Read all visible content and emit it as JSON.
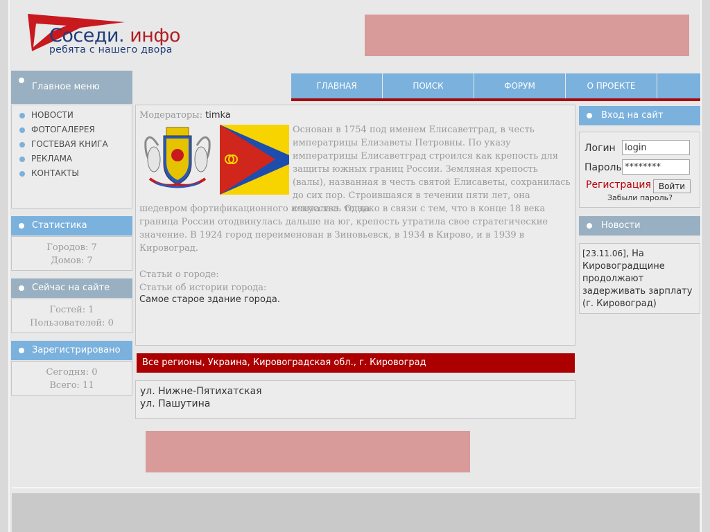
{
  "logo": {
    "name_main": "Соседи.",
    "name_accent": " инфо",
    "tagline": "ребята с нашего двора"
  },
  "left": {
    "main_menu": {
      "title": "Главное меню",
      "items": [
        "НОВОСТИ",
        "ФОТОГАЛЕРЕЯ",
        "ГОСТЕВАЯ КНИГА",
        "РЕКЛАМА",
        "КОНТАКТЫ"
      ]
    },
    "stats": {
      "title": "Статистика",
      "cities": "Городов: 7",
      "houses": "Домов: 7"
    },
    "online": {
      "title": "Сейчас на сайте",
      "guests": "Гостей: 1",
      "users": "Пользователей: 0"
    },
    "registered": {
      "title": "Зарегистрировано",
      "today": "Сегодня: 0",
      "total": "Всего: 11"
    }
  },
  "nav": {
    "items": [
      "ГЛАВНАЯ",
      "ПОИСК",
      "ФОРУМ",
      "О ПРОЕКТЕ"
    ]
  },
  "content": {
    "moderators_label": "Модераторы:",
    "moderator": "timka",
    "description_top": "Основан в 1754 под именем Елисаветград, в честь императрицы Елизаветы Петровны. По указу императрицы Елисаветград строился как крепость для защиты южных границ России. Земляная крепость (валы), названная в честь святой Елисаветы, сохранилась до сих пор. Строившаяся в течении пяти лет, она считалась тогда",
    "description_bottom": "шедевром фортификационного искусства. Однако в связи с тем, что в конце 18 века граница России отодвинулась дальше на юг, крепость утратила свое стратегические значение. В 1924 город переименован в Зиновьевск, в 1934 в Кирово, и в 1939 в Кировоград.",
    "articles_city": "Статьи о городе:",
    "articles_history": "Статьи об истории города:",
    "article_link": "Самое старое здание города.",
    "region_path": "Все регионы, Украина, Кировоградская обл., г. Кировоград",
    "streets": [
      "ул. Нижне-Пятихатская",
      "ул. Пашутина"
    ]
  },
  "login": {
    "title": "Вход на сайт",
    "login_label": "Логин",
    "login_value": "login",
    "password_label": "Пароль",
    "password_value": "********",
    "register_link": "Регистрация",
    "submit": "Войти",
    "forgot": "Забыли пароль?"
  },
  "news": {
    "title": "Новости",
    "date": "[23.11.06]",
    "text": ", На Кировоградщине продолжают задерживать зарплату (г. Кировоград)"
  },
  "colors": {
    "nav_blue": "#7bb1dd",
    "region_red": "#ac0000",
    "banner_pink": "#d99a9a",
    "logo_blue": "#1e3d7a",
    "logo_red": "#b01e23"
  }
}
